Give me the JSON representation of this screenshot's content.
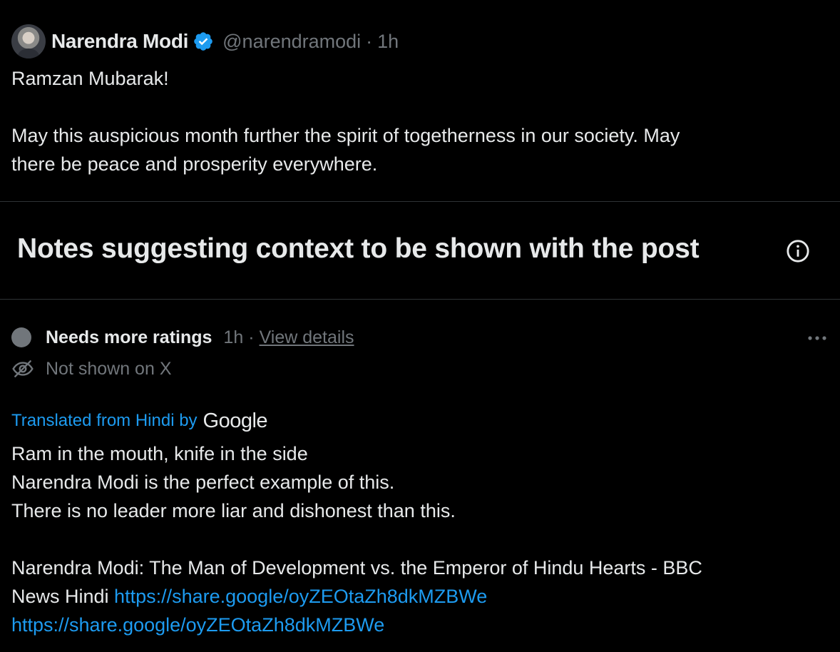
{
  "post": {
    "author_name": "Narendra Modi",
    "handle": "@narendramodi",
    "separator": "·",
    "time": "1h",
    "text_line_1": "Ramzan Mubarak!",
    "text_line_2": "May this auspicious month further the spirit of togetherness in our society. May",
    "text_line_3": "there be peace and prosperity everywhere."
  },
  "notes_section": {
    "title": "Notes suggesting context to be shown with the post",
    "info_icon": "info-icon"
  },
  "note": {
    "status_label": "Needs more ratings",
    "time": "1h",
    "separator": "·",
    "view_details": "View details",
    "visibility": "Not shown on X",
    "translated_label": "Translated from Hindi by",
    "translator_logo": "Google",
    "body_line_1": "Ram in the mouth, knife in the side",
    "body_line_2": "Narendra Modi is the perfect example of this.",
    "body_line_3": "There is no leader more liar and dishonest than this.",
    "body_line_4": "Narendra Modi: The Man of Development vs. the Emperor of Hindu Hearts - BBC",
    "body_line_5_text": "News Hindi ",
    "link_1": "https://share.google/oyZEOtaZh8dkMZBWe",
    "link_2": "https://share.google/oyZEOtaZh8dkMZBWe"
  },
  "colors": {
    "background": "#000000",
    "text_primary": "#e7e9ea",
    "text_secondary": "#71767b",
    "accent": "#1d9bf0",
    "divider": "#2f3336"
  },
  "icons": {
    "verified": "verified-badge-icon",
    "info": "info-icon",
    "more": "more-options-icon",
    "visibility": "eye-off-icon",
    "status": "status-dot-icon"
  }
}
